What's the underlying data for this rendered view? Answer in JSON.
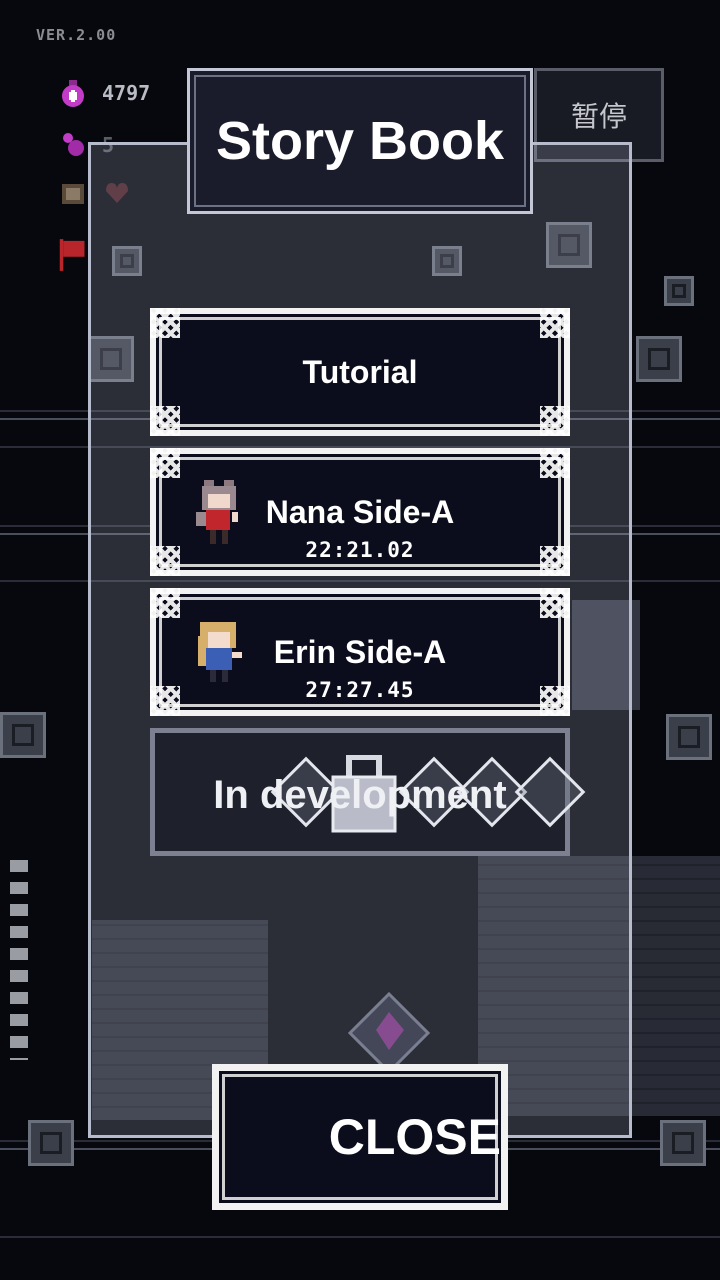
{
  "version": "VER.2.00",
  "hud": {
    "potion_icon": "potion-icon",
    "potion_count": "4797",
    "gem_icon": "gem-icon",
    "gem_count": "5",
    "heart_icon": "heart-icon",
    "flag_icon": "flag-icon"
  },
  "pause_label": "暂停",
  "dialog": {
    "title": "Story Book",
    "entries": [
      {
        "label": "Tutorial",
        "time": ""
      },
      {
        "label": "Nana Side-A",
        "time": "22:21.02",
        "avatar": "nana-sprite-icon"
      },
      {
        "label": "Erin Side-A",
        "time": "27:27.45",
        "avatar": "erin-sprite-icon"
      }
    ],
    "locked_label": "In development",
    "close_label": "CLOSE"
  },
  "colors": {
    "background": "#07080d",
    "button_fill": "#0b0d1c",
    "frame": "#f2f2f2",
    "accent_purple": "#c23cc8",
    "accent_red": "#b8262c"
  }
}
